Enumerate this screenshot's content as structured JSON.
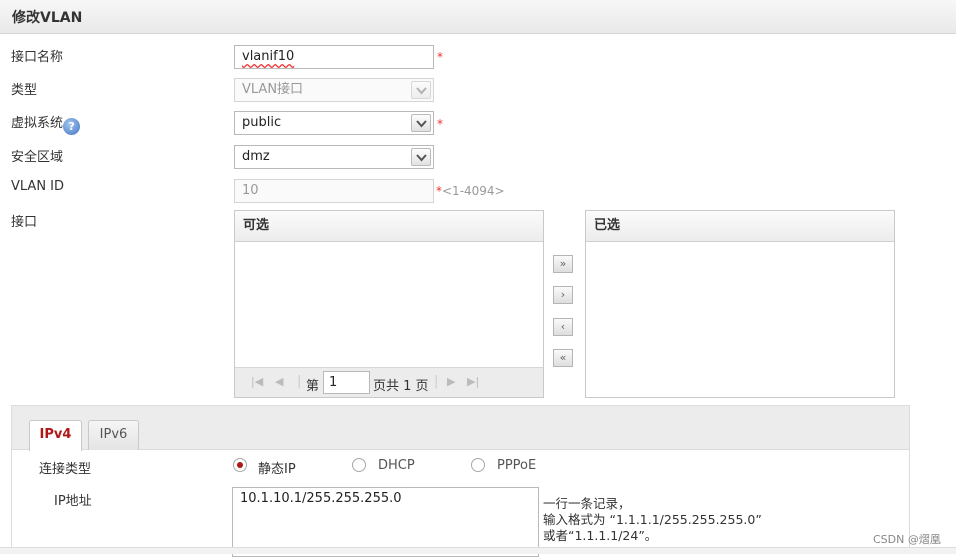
{
  "title": "修改VLAN",
  "form": {
    "interface_name": {
      "label": "接口名称",
      "value": "vlanif10",
      "required": "*"
    },
    "type": {
      "label": "类型",
      "value": "VLAN接口"
    },
    "virtual_system": {
      "label": "虚拟系统",
      "help": "?",
      "value": "public",
      "required": "*"
    },
    "security_zone": {
      "label": "安全区域",
      "value": "dmz"
    },
    "vlan_id": {
      "label": "VLAN ID",
      "value": "10",
      "hint": "*<1-4094>"
    },
    "interface": {
      "label": "接口"
    }
  },
  "transfer": {
    "available_title": "可选",
    "selected_title": "已选",
    "pager": {
      "page_prefix": "第",
      "page_value": "1",
      "page_suffix": "页共 1 页"
    },
    "buttons": {
      "add_all": "»",
      "add": "›",
      "remove": "‹",
      "remove_all": "«"
    }
  },
  "ip_tabs": [
    {
      "label": "IPv4"
    },
    {
      "label": "IPv6"
    }
  ],
  "connection": {
    "label": "连接类型",
    "options": [
      {
        "label": "静态IP",
        "selected": true
      },
      {
        "label": "DHCP",
        "selected": false
      },
      {
        "label": "PPPoE",
        "selected": false
      }
    ]
  },
  "ip_address": {
    "label": "IP地址",
    "value": "10.1.10.1/255.255.255.0",
    "note_lines": [
      "一行一条记录，",
      "输入格式为 “1.1.1.1/255.255.255.0”",
      "或者“1.1.1.1/24”。"
    ]
  },
  "watermark": "CSDN @熠凰",
  "colors": {
    "accent": "#b01818",
    "required": "#e33333"
  }
}
